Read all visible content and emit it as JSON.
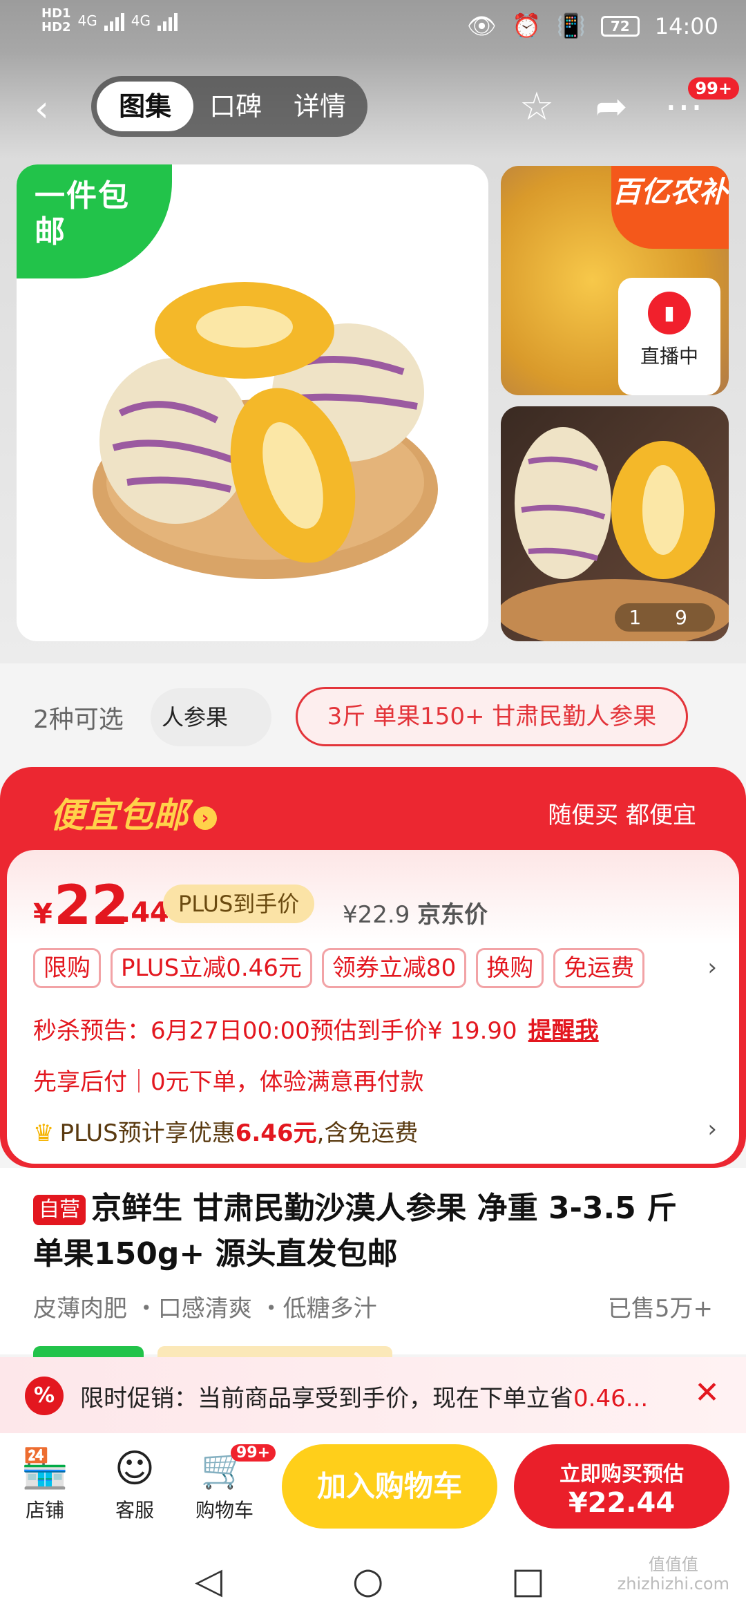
{
  "status_bar": {
    "hd1": "HD1",
    "hd2": "HD2",
    "net1": "4G",
    "net2": "4G",
    "battery": "72",
    "time": "14:00"
  },
  "header": {
    "tabs": [
      {
        "label": "图集",
        "active": true
      },
      {
        "label": "口碑",
        "active": false
      },
      {
        "label": "详情",
        "active": false
      }
    ],
    "message_badge": "99+"
  },
  "gallery": {
    "main_tag": "一件包邮",
    "nongbu_badge": "百亿农补",
    "live_label": "直播中",
    "counter": "1 9"
  },
  "specs": {
    "count_label": "2种可选",
    "option_1": "人参果",
    "option_2": "3斤 单果150+ 甘肃民勤人参果"
  },
  "promo": {
    "title": "便宜包邮",
    "slogan": "随便买 都便宜",
    "price_symbol": "¥",
    "price_int": "22",
    "price_dec": ".44",
    "plus_label": "PLUS到手价",
    "jd_price": "¥22.9",
    "jd_price_label": "京东价",
    "tags": [
      "限购",
      "PLUS立减0.46元",
      "领券立减80",
      "换购",
      "免运费"
    ],
    "seckill": "秒杀预告：6月27日00:00预估到手价¥ 19.90",
    "seckill_remind": "提醒我",
    "paylater": "先享后付｜0元下单，体验满意再付款",
    "plus_line_a": "PLUS预计享优惠",
    "plus_line_amount": "6.46元",
    "plus_line_b": ",含免运费"
  },
  "product": {
    "self_tag": "自营",
    "title": "京鲜生 甘肃民勤沙漠人参果 净重 3-3.5 斤 单果150g+ 源头直发包邮",
    "features": "皮薄肉肥 ・口感清爽 ・低糖多汁",
    "sold": "已售5万+"
  },
  "timed_promo": {
    "icon": "%",
    "text": "限时促销：当前商品享受到手价，现在下单立省",
    "amount": "0.46..."
  },
  "action_bar": {
    "shop": "店铺",
    "service": "客服",
    "cart": "购物车",
    "cart_badge": "99+",
    "add_to_cart": "加入购物车",
    "buy_line1": "立即购买预估",
    "buy_line2": "¥22.44"
  },
  "watermark": {
    "line1": "值值值",
    "line2": "zhizhizhi.com"
  },
  "colors": {
    "accent_red": "#e3171f",
    "promo_gold": "#ffd24a",
    "cart_yellow": "#ffcf1a",
    "green_tag": "#22c34a"
  }
}
